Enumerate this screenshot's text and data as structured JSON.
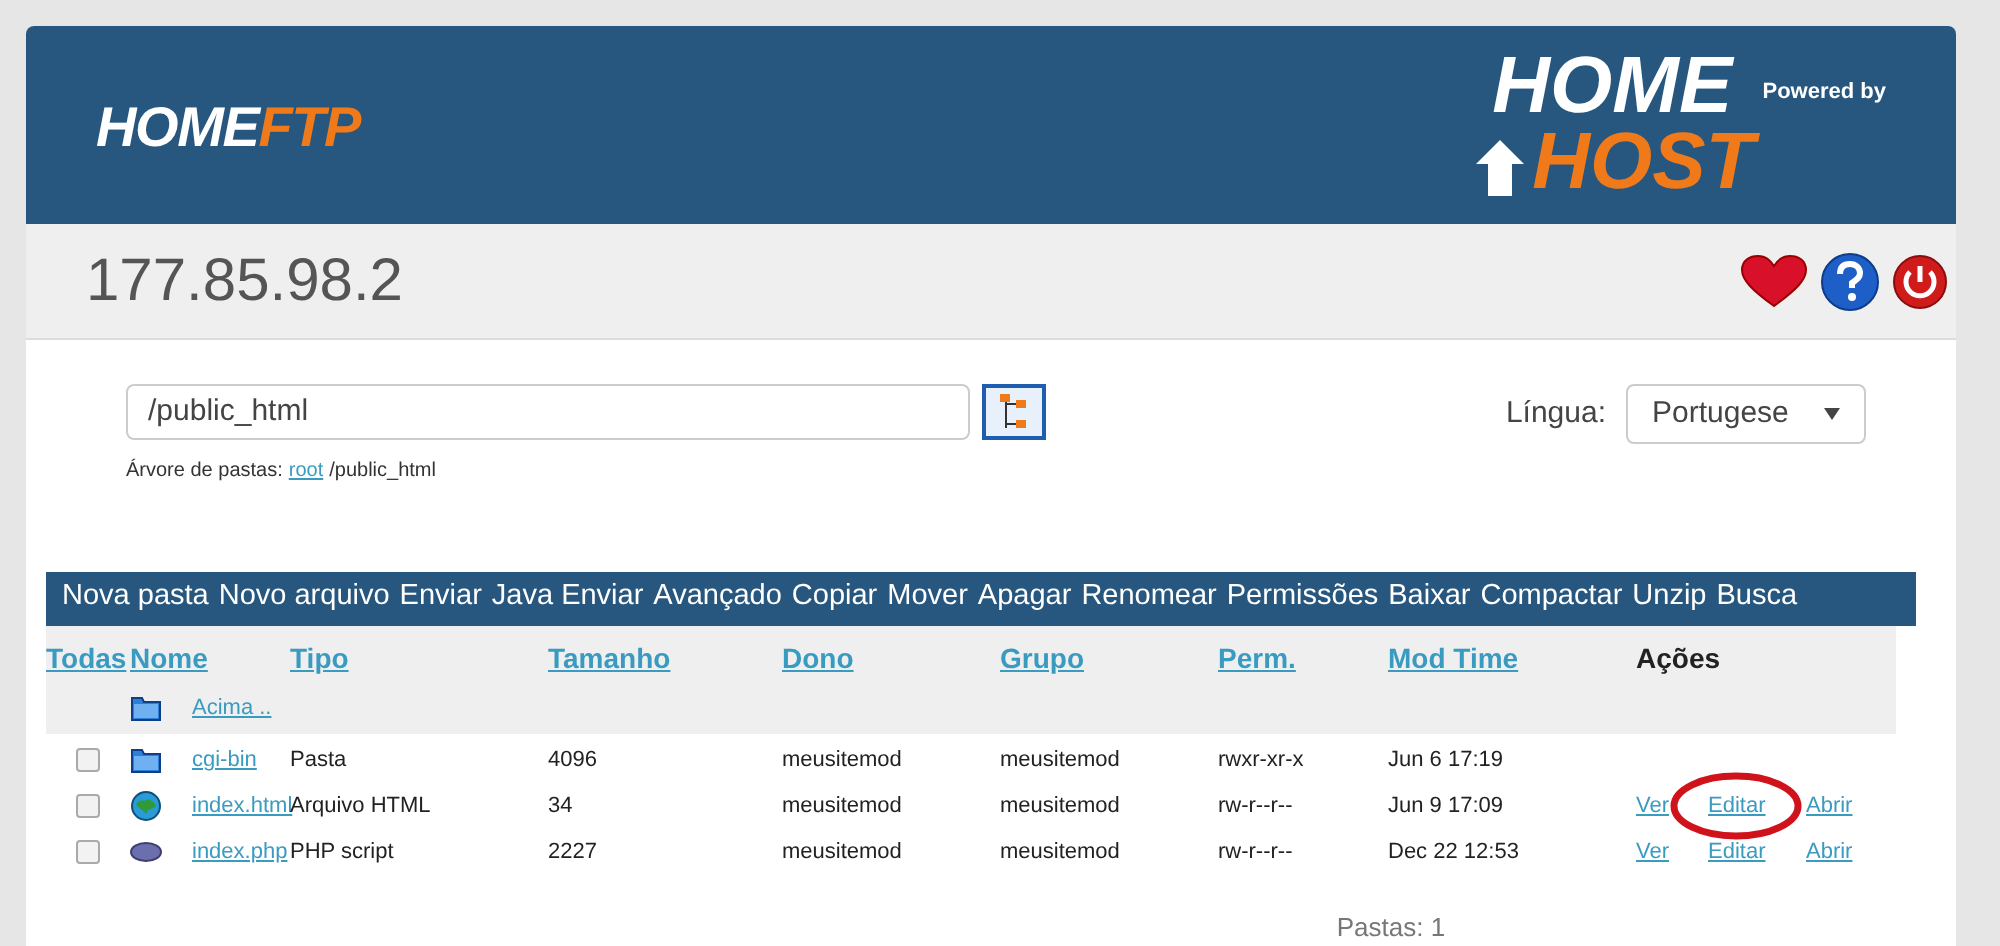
{
  "header": {
    "logo": {
      "first": "HOME",
      "second": "FTP"
    },
    "brand": {
      "top": "HOME",
      "powered": "Powered by",
      "bottom": "HOST"
    }
  },
  "server": {
    "address": "177.85.98.2"
  },
  "path": {
    "value": "/public_html",
    "tree_label": "Árvore de pastas:",
    "tree_link": "root",
    "tree_rest": "/public_html"
  },
  "language": {
    "label": "Língua:",
    "value": "Portugese"
  },
  "toolbar": [
    "Nova pasta",
    "Novo arquivo",
    "Enviar",
    "Java Enviar",
    "Avançado",
    "Copiar",
    "Mover",
    "Apagar",
    "Renomear",
    "Permissões",
    "Baixar",
    "Compactar",
    "Unzip",
    "Busca"
  ],
  "table": {
    "columns": [
      "Todas",
      "Nome",
      "Tipo",
      "Tamanho",
      "Dono",
      "Grupo",
      "Perm.",
      "Mod Time",
      "Ações"
    ],
    "up": {
      "label": "Acima .."
    },
    "rows": [
      {
        "checked": false,
        "kind": "folder",
        "name": "cgi-bin",
        "type": "Pasta",
        "size": "4096",
        "owner": "meusitemod",
        "group": "meusitemod",
        "perm": "rwxr-xr-x",
        "mod_time": "Jun 6 17:19",
        "actions": []
      },
      {
        "checked": false,
        "kind": "html",
        "name": "index.html",
        "type": "Arquivo HTML",
        "size": "34",
        "owner": "meusitemod",
        "group": "meusitemod",
        "perm": "rw-r--r--",
        "mod_time": "Jun 9 17:09",
        "actions": [
          "Ver",
          "Editar",
          "Abrir"
        ]
      },
      {
        "checked": false,
        "kind": "php",
        "name": "index.php",
        "type": "PHP script",
        "size": "2227",
        "owner": "meusitemod",
        "group": "meusitemod",
        "perm": "rw-r--r--",
        "mod_time": "Dec 22 12:53",
        "actions": [
          "Ver",
          "Editar",
          "Abrir"
        ]
      }
    ]
  },
  "footer": {
    "count": "Pastas: 1"
  }
}
